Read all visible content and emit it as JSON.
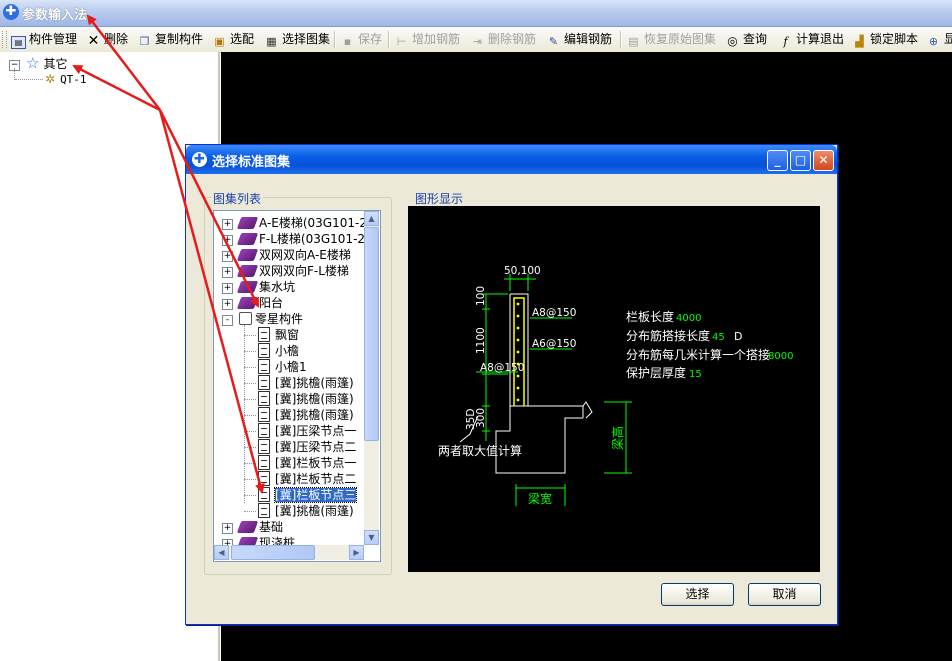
{
  "main_window": {
    "title": "参数输入法"
  },
  "toolbar": {
    "items": [
      {
        "label": "构件管理",
        "icon": "grid-icon",
        "enabled": true
      },
      {
        "label": "删除",
        "icon": "delete-icon",
        "enabled": true
      },
      {
        "label": "复制构件",
        "icon": "copy-icon",
        "enabled": true
      },
      {
        "label": "选配",
        "icon": "select-match-icon",
        "enabled": true
      },
      {
        "label": "选择图集",
        "icon": "atlas-icon",
        "enabled": true
      },
      {
        "label": "保存",
        "icon": "save-icon",
        "enabled": false
      },
      {
        "label": "增加钢筋",
        "icon": "add-rebar-icon",
        "enabled": false
      },
      {
        "label": "删除钢筋",
        "icon": "remove-rebar-icon",
        "enabled": false
      },
      {
        "label": "编辑钢筋",
        "icon": "edit-rebar-icon",
        "enabled": true
      },
      {
        "label": "恢复原始图集",
        "icon": "restore-icon",
        "enabled": false
      },
      {
        "label": "查询",
        "icon": "binoculars-icon",
        "enabled": true
      },
      {
        "label": "计算退出",
        "icon": "function-icon",
        "enabled": true
      },
      {
        "label": "锁定脚本",
        "icon": "lock-icon",
        "enabled": true
      },
      {
        "label": "显",
        "icon": "zoom-icon",
        "enabled": true
      }
    ]
  },
  "left_tree": {
    "root": {
      "label": "其它",
      "icon": "star-icon"
    },
    "child": {
      "label": "QT-1",
      "icon": "gear-icon"
    }
  },
  "dialog": {
    "title": "选择标准图集",
    "list_group_label": "图集列表",
    "preview_group_label": "图形显示",
    "atlas_items": [
      {
        "label": "A-E楼梯(03G101-2)",
        "type": "book",
        "expand": "+"
      },
      {
        "label": "F-L楼梯(03G101-2)",
        "type": "book",
        "expand": "+"
      },
      {
        "label": "双网双向A-E楼梯",
        "type": "book",
        "expand": "+"
      },
      {
        "label": "双网双向F-L楼梯",
        "type": "book",
        "expand": "+"
      },
      {
        "label": "集水坑",
        "type": "book",
        "expand": "+"
      },
      {
        "label": "阳台",
        "type": "book",
        "expand": "+"
      },
      {
        "label": "零星构件",
        "type": "openbook",
        "expand": "-"
      },
      {
        "label": "飘窗",
        "type": "doc"
      },
      {
        "label": "小檐",
        "type": "doc"
      },
      {
        "label": "小檐1",
        "type": "doc"
      },
      {
        "label": "[冀]挑檐(雨篷)",
        "type": "doc"
      },
      {
        "label": "[冀]挑檐(雨篷)",
        "type": "doc"
      },
      {
        "label": "[冀]挑檐(雨篷)",
        "type": "doc"
      },
      {
        "label": "[冀]压梁节点一",
        "type": "doc"
      },
      {
        "label": "[冀]压梁节点二",
        "type": "doc"
      },
      {
        "label": "[冀]栏板节点一",
        "type": "doc"
      },
      {
        "label": "[冀]栏板节点二",
        "type": "doc"
      },
      {
        "label": "[冀]栏板节点三",
        "type": "doc",
        "selected": true
      },
      {
        "label": "[冀]挑檐(雨篷)",
        "type": "doc"
      },
      {
        "label": "基础",
        "type": "book",
        "expand": "+"
      },
      {
        "label": "现浇桩",
        "type": "book",
        "expand": "+"
      }
    ],
    "drawing": {
      "dims": {
        "top_width": "50,100",
        "h100": "100",
        "h1100": "1100",
        "h300": "300",
        "h35d": "35D"
      },
      "rebar_labels": [
        "A8@150",
        "A6@150",
        "A8@150"
      ],
      "note": "两者取大值计算",
      "beam_height": "梁高",
      "beam_width": "梁宽",
      "params": [
        {
          "label": "栏板长度",
          "value": "4000"
        },
        {
          "label": "分布筋搭接长度",
          "value": "45",
          "unit": "D"
        },
        {
          "label": "分布筋每几米计算一个搭接",
          "value": "8000"
        },
        {
          "label": "保护层厚度",
          "value": "15"
        }
      ]
    },
    "buttons": {
      "select": "选择",
      "cancel": "取消"
    }
  },
  "colors": {
    "accent": "#0a5ee8",
    "drawing_green": "#00ff00",
    "annotation_red": "#e51c1c",
    "selection": "#316ac5"
  }
}
